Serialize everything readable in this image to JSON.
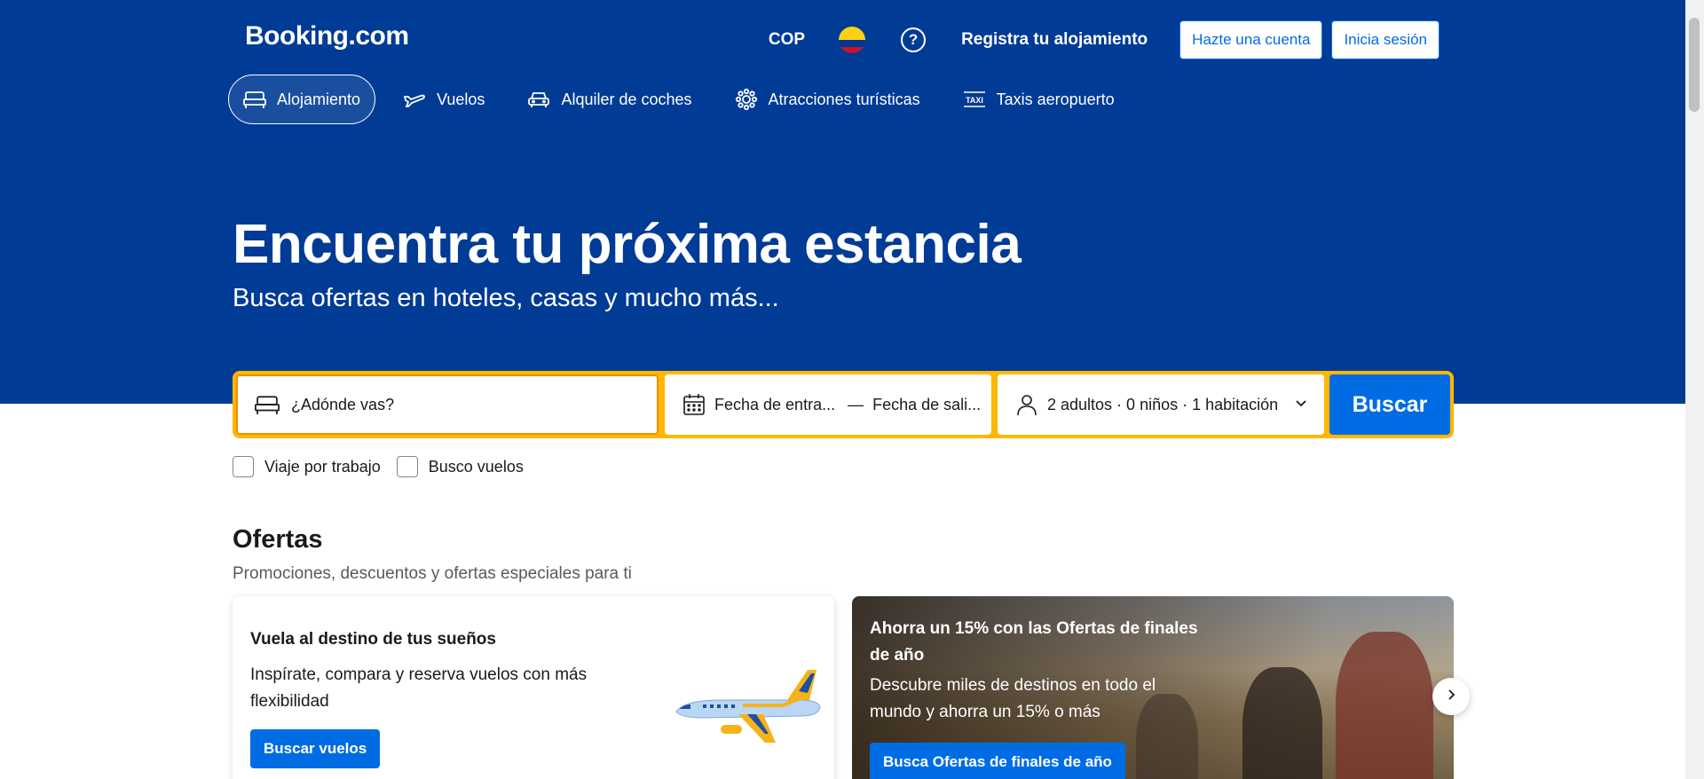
{
  "header": {
    "logo": "Booking.com",
    "currency": "COP",
    "flag_icon": "colombia-flag-icon",
    "help_icon": "question-circle-icon",
    "list_property": "Registra tu alojamiento",
    "register_button": "Hazte una cuenta",
    "signin_button": "Inicia sesión"
  },
  "nav": {
    "items": [
      {
        "label": "Alojamiento",
        "icon": "bed-icon",
        "active": true
      },
      {
        "label": "Vuelos",
        "icon": "plane-icon"
      },
      {
        "label": "Alquiler de coches",
        "icon": "car-icon"
      },
      {
        "label": "Atracciones turísticas",
        "icon": "attractions-icon"
      },
      {
        "label": "Taxis aeropuerto",
        "icon": "taxi-icon"
      }
    ]
  },
  "hero": {
    "title": "Encuentra tu próxima estancia",
    "subtitle": "Busca ofertas en hoteles, casas y mucho más..."
  },
  "search": {
    "destination_placeholder": "¿Adónde vas?",
    "checkin": "Fecha de entra...",
    "separator": "—",
    "checkout": "Fecha de sali...",
    "guests": "2 adultos · 0 niños · 1 habitación",
    "button": "Buscar",
    "colors": {
      "border": "#ffb700",
      "button": "#006ce4"
    }
  },
  "options": {
    "work_travel": "Viaje por trabajo",
    "flights": "Busco vuelos"
  },
  "offers": {
    "title": "Ofertas",
    "subtitle": "Promociones, descuentos y ofertas especiales para ti",
    "cards": [
      {
        "title": "Vuela al destino de tus sueños",
        "description": "Inspírate, compara y reserva vuelos con más flexibilidad",
        "button": "Buscar vuelos"
      },
      {
        "title": "Ahorra un 15% con las Ofertas de finales de año",
        "description": "Descubre miles de destinos en todo el mundo y ahorra un 15% o más",
        "button": "Busca Ofertas de finales de año"
      }
    ]
  },
  "colors": {
    "brand": "#003b95",
    "accent": "#006ce4"
  }
}
